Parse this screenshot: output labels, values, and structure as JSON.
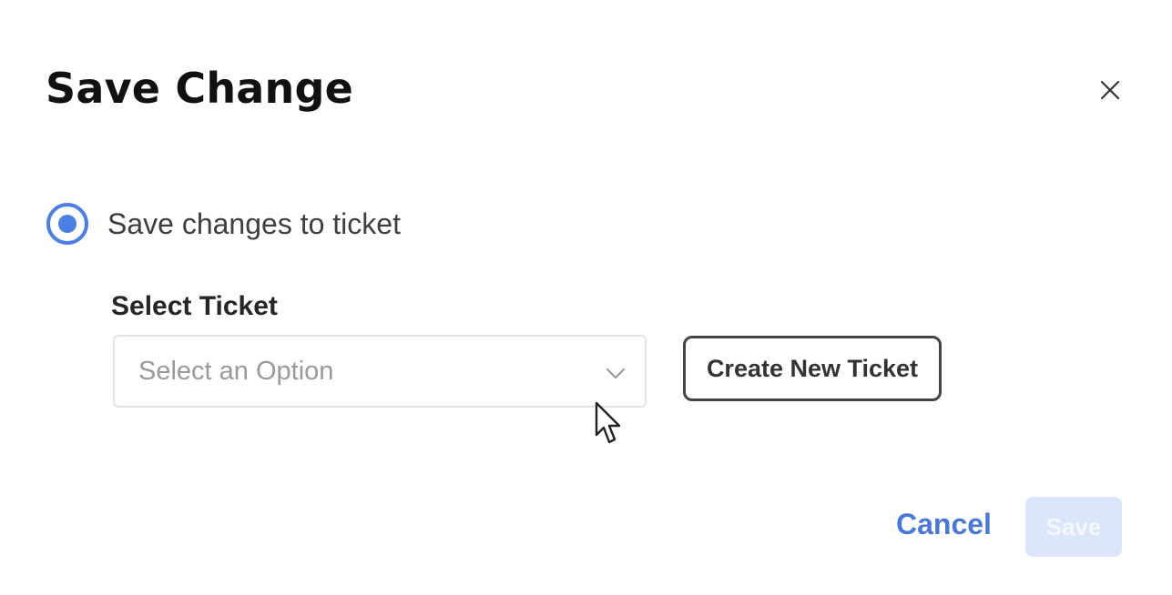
{
  "dialog": {
    "title": "Save Change",
    "close_icon": "close-icon"
  },
  "option": {
    "label": "Save changes to ticket",
    "selected": true
  },
  "ticket_select": {
    "label": "Select Ticket",
    "placeholder": "Select an Option",
    "chevron_icon": "chevron-down-icon"
  },
  "buttons": {
    "create_new": "Create New Ticket",
    "cancel": "Cancel",
    "save": "Save",
    "save_disabled": true
  },
  "colors": {
    "accent": "#4a78d4",
    "radio": "#4c7fe6",
    "save_disabled_bg": "#dbe6fa"
  }
}
